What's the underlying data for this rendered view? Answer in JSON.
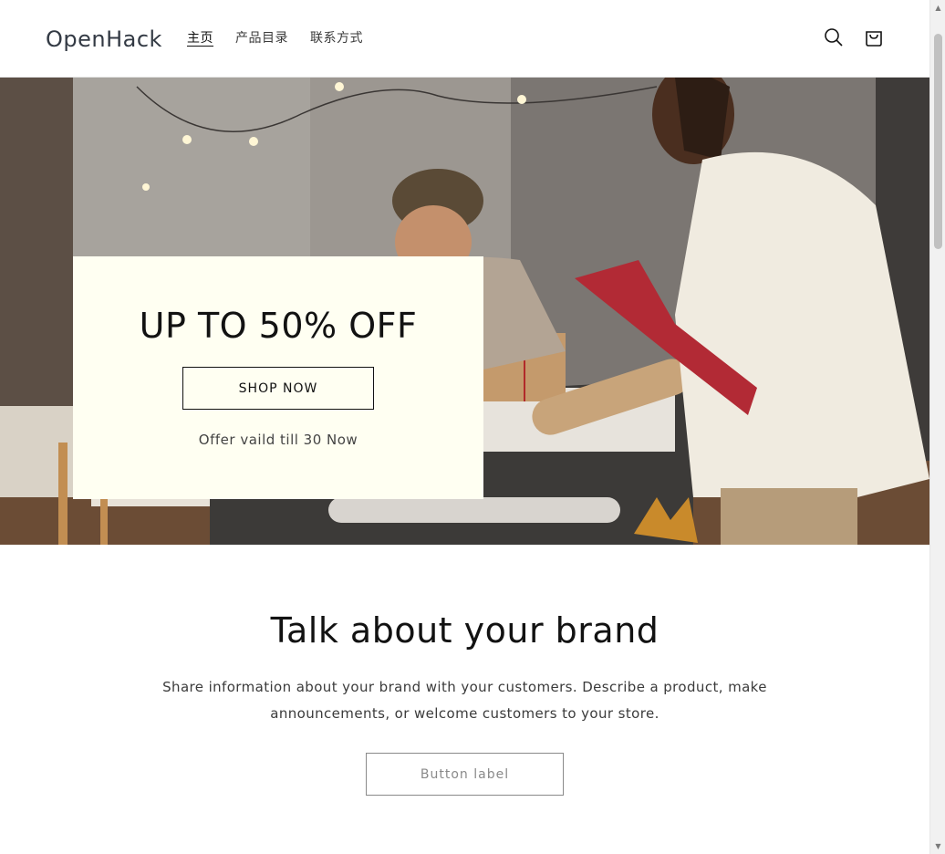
{
  "header": {
    "logo": "OpenHack",
    "nav": [
      {
        "label": "主页",
        "active": true
      },
      {
        "label": "产品目录",
        "active": false
      },
      {
        "label": "联系方式",
        "active": false
      }
    ],
    "icons": [
      "search-icon",
      "cart-icon"
    ]
  },
  "hero": {
    "heading": "UP TO 50% OFF",
    "button_label": "SHOP NOW",
    "caption": "Offer vaild till 30 Now",
    "image_description": "people-wrapping-gifts-photo"
  },
  "brand": {
    "title": "Talk about your brand",
    "text": "Share information about your brand with your customers. Describe a product, make announcements, or welcome customers to your store.",
    "button_label": "Button label"
  },
  "colors": {
    "promo_background": "#fffff2",
    "text_primary": "#121212",
    "button_border_muted": "#8a8a8a"
  }
}
